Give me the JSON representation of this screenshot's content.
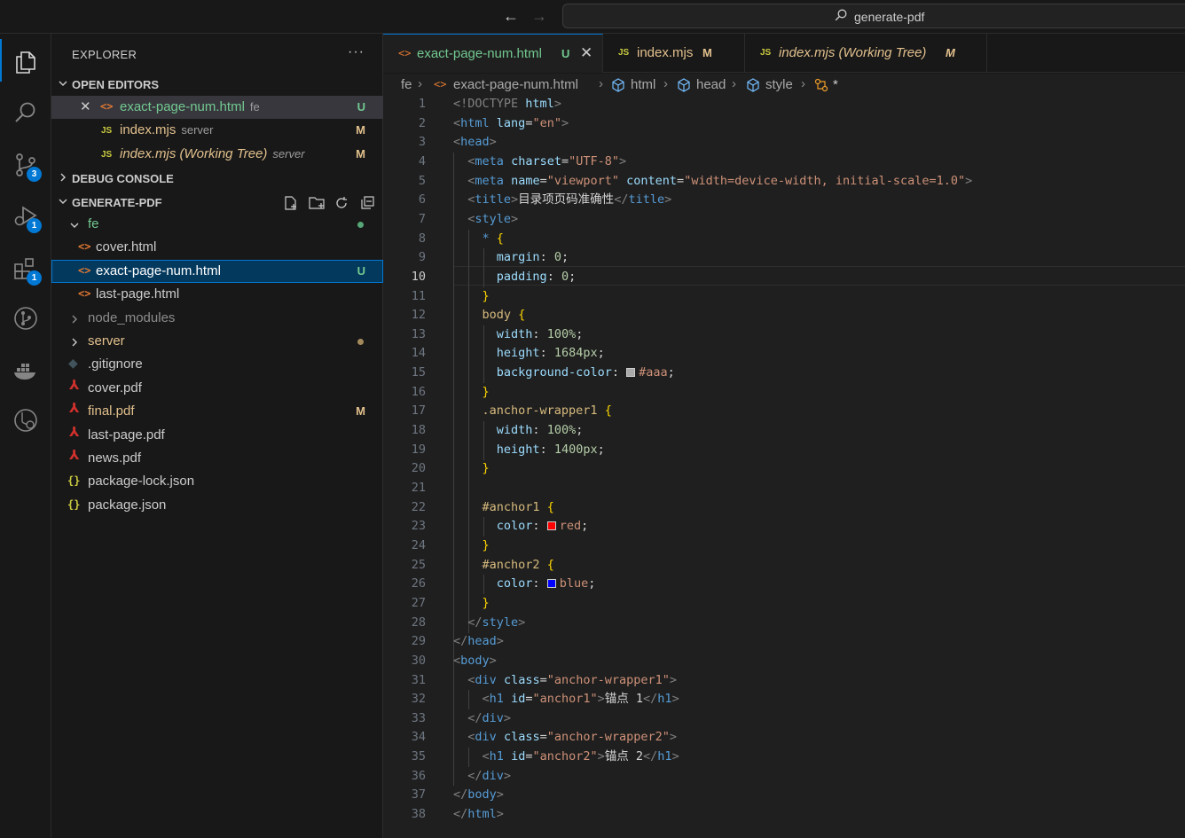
{
  "titlebar": {
    "back_icon": "arrow-left-icon",
    "forward_icon": "arrow-right-icon",
    "search_text": "generate-pdf"
  },
  "activity_bar": {
    "items": [
      {
        "name": "explorer-icon",
        "active": true
      },
      {
        "name": "search-icon"
      },
      {
        "name": "source-control-icon",
        "badge": "3"
      },
      {
        "name": "run-debug-icon",
        "badge": "1"
      },
      {
        "name": "extensions-icon",
        "badge": "1"
      },
      {
        "name": "git-graph-icon"
      },
      {
        "name": "docker-icon"
      },
      {
        "name": "remote-explorer-icon"
      }
    ]
  },
  "sidebar": {
    "title": "EXPLORER",
    "more": "···",
    "open_editors": {
      "title": "OPEN EDITORS",
      "items": [
        {
          "name": "exact-page-num.html",
          "desc": "fe",
          "status": "U"
        },
        {
          "name": "index.mjs",
          "desc": "server",
          "status": "M"
        },
        {
          "name": "index.mjs (Working Tree)",
          "desc": "server",
          "status": "M"
        }
      ]
    },
    "debug_console": {
      "title": "DEBUG CONSOLE"
    },
    "workspace": {
      "title": "GENERATE-PDF",
      "tree": [
        {
          "name": "fe",
          "type": "folder"
        },
        {
          "name": "cover.html",
          "type": "html"
        },
        {
          "name": "exact-page-num.html",
          "type": "html",
          "status": "U"
        },
        {
          "name": "last-page.html",
          "type": "html"
        },
        {
          "name": "node_modules",
          "type": "folder"
        },
        {
          "name": "server",
          "type": "folder"
        },
        {
          "name": ".gitignore",
          "type": "git"
        },
        {
          "name": "cover.pdf",
          "type": "pdf"
        },
        {
          "name": "final.pdf",
          "type": "pdf",
          "status": "M"
        },
        {
          "name": "last-page.pdf",
          "type": "pdf"
        },
        {
          "name": "news.pdf",
          "type": "pdf"
        },
        {
          "name": "package-lock.json",
          "type": "json"
        },
        {
          "name": "package.json",
          "type": "json"
        }
      ]
    }
  },
  "tabs": [
    {
      "label": "exact-page-num.html",
      "status": "U",
      "active": true
    },
    {
      "label": "index.mjs",
      "status": "M"
    },
    {
      "label": "index.mjs (Working Tree)",
      "status": "M"
    }
  ],
  "breadcrumbs": [
    "fe",
    "exact-page-num.html",
    "html",
    "head",
    "style",
    "*"
  ],
  "colors": {
    "accent": "#0078d4",
    "untracked": "#73c991",
    "modified": "#e2c08d",
    "swatch_aaa": "#aaaaaa",
    "swatch_red": "#ff0000",
    "swatch_blue": "#0000ff"
  },
  "editor": {
    "current_line": "10",
    "line_numbers": [
      "1",
      "2",
      "3",
      "4",
      "5",
      "6",
      "7",
      "8",
      "9",
      "10",
      "11",
      "12",
      "13",
      "14",
      "15",
      "16",
      "17",
      "18",
      "19",
      "20",
      "21",
      "22",
      "23",
      "24",
      "25",
      "26",
      "27",
      "28",
      "29",
      "30",
      "31",
      "32",
      "33",
      "34",
      "35",
      "36",
      "37",
      "38"
    ],
    "code": {
      "doctype": "<!DOCTYPE",
      "html_kw": "html",
      "gt": ">",
      "lt": "<",
      "lt_slash": "</",
      "tag_html": "html",
      "tag_head": "head",
      "tag_meta": "meta",
      "tag_title": "title",
      "tag_style": "style",
      "tag_body": "body",
      "tag_div": "div",
      "tag_h1": "h1",
      "attr_lang": "lang",
      "attr_charset": "charset",
      "attr_name": "name",
      "attr_content": "content",
      "attr_class": "class",
      "attr_id": "id",
      "eq": "=",
      "val_en": "\"en\"",
      "val_utf8": "\"UTF-8\"",
      "val_viewport": "\"viewport\"",
      "val_content": "\"width=device-width, initial-scale=1.0\"",
      "title_text": "目录项页码准确性",
      "sel_star": "*",
      "sel_body": "body",
      "sel_wrapper1": ".anchor-wrapper1",
      "sel_anchor1": "#anchor1",
      "sel_anchor2": "#anchor2",
      "brace_open": "{",
      "brace_close": "}",
      "prop_margin": "margin",
      "prop_padding": "padding",
      "prop_width": "width",
      "prop_height": "height",
      "prop_bg": "background-color",
      "prop_color": "color",
      "colon": ":",
      "semi": ";",
      "num_0": "0",
      "num_100p": "100%",
      "num_1684": "1684px",
      "num_1400": "1400px",
      "val_aaa": "#aaa",
      "val_red": "red",
      "val_blue": "blue",
      "val_wrapper1": "\"anchor-wrapper1\"",
      "val_wrapper2": "\"anchor-wrapper2\"",
      "val_anchor1": "\"anchor1\"",
      "val_anchor2": "\"anchor2\"",
      "h1_text1": "锚点 1",
      "h1_text2": "锚点 2"
    }
  }
}
